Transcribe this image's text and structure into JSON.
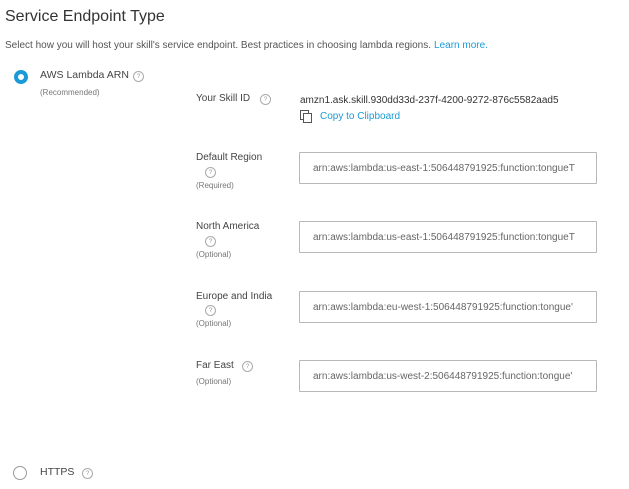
{
  "header": {
    "title": "Service Endpoint Type",
    "description": "Select how you will host your skill's service endpoint. Best practices in choosing lambda regions.",
    "learn_more": "Learn more."
  },
  "options": {
    "lambda": {
      "label": "AWS Lambda ARN",
      "note": "(Recommended)",
      "selected": true
    },
    "https": {
      "label": "HTTPS",
      "selected": false
    }
  },
  "skill": {
    "id_label": "Your Skill ID",
    "id_value": "amzn1.ask.skill.930dd33d-237f-4200-9272-876c5582aad5",
    "copy_label": "Copy to Clipboard"
  },
  "regions": [
    {
      "label": "Default Region",
      "requirement": "(Required)",
      "value": "arn:aws:lambda:us-east-1:506448791925:function:tongueT"
    },
    {
      "label": "North America",
      "requirement": "(Optional)",
      "value": "arn:aws:lambda:us-east-1:506448791925:function:tongueT"
    },
    {
      "label": "Europe and India",
      "requirement": "(Optional)",
      "value": "arn:aws:lambda:eu-west-1:506448791925:function:tongue'"
    },
    {
      "label": "Far East",
      "requirement": "(Optional)",
      "value": "arn:aws:lambda:us-west-2:506448791925:function:tongue'"
    }
  ],
  "help_glyph": "?",
  "colors": {
    "accent": "#1a9bd7",
    "text": "#444444",
    "muted": "#777777",
    "border": "#b8b8b8"
  }
}
